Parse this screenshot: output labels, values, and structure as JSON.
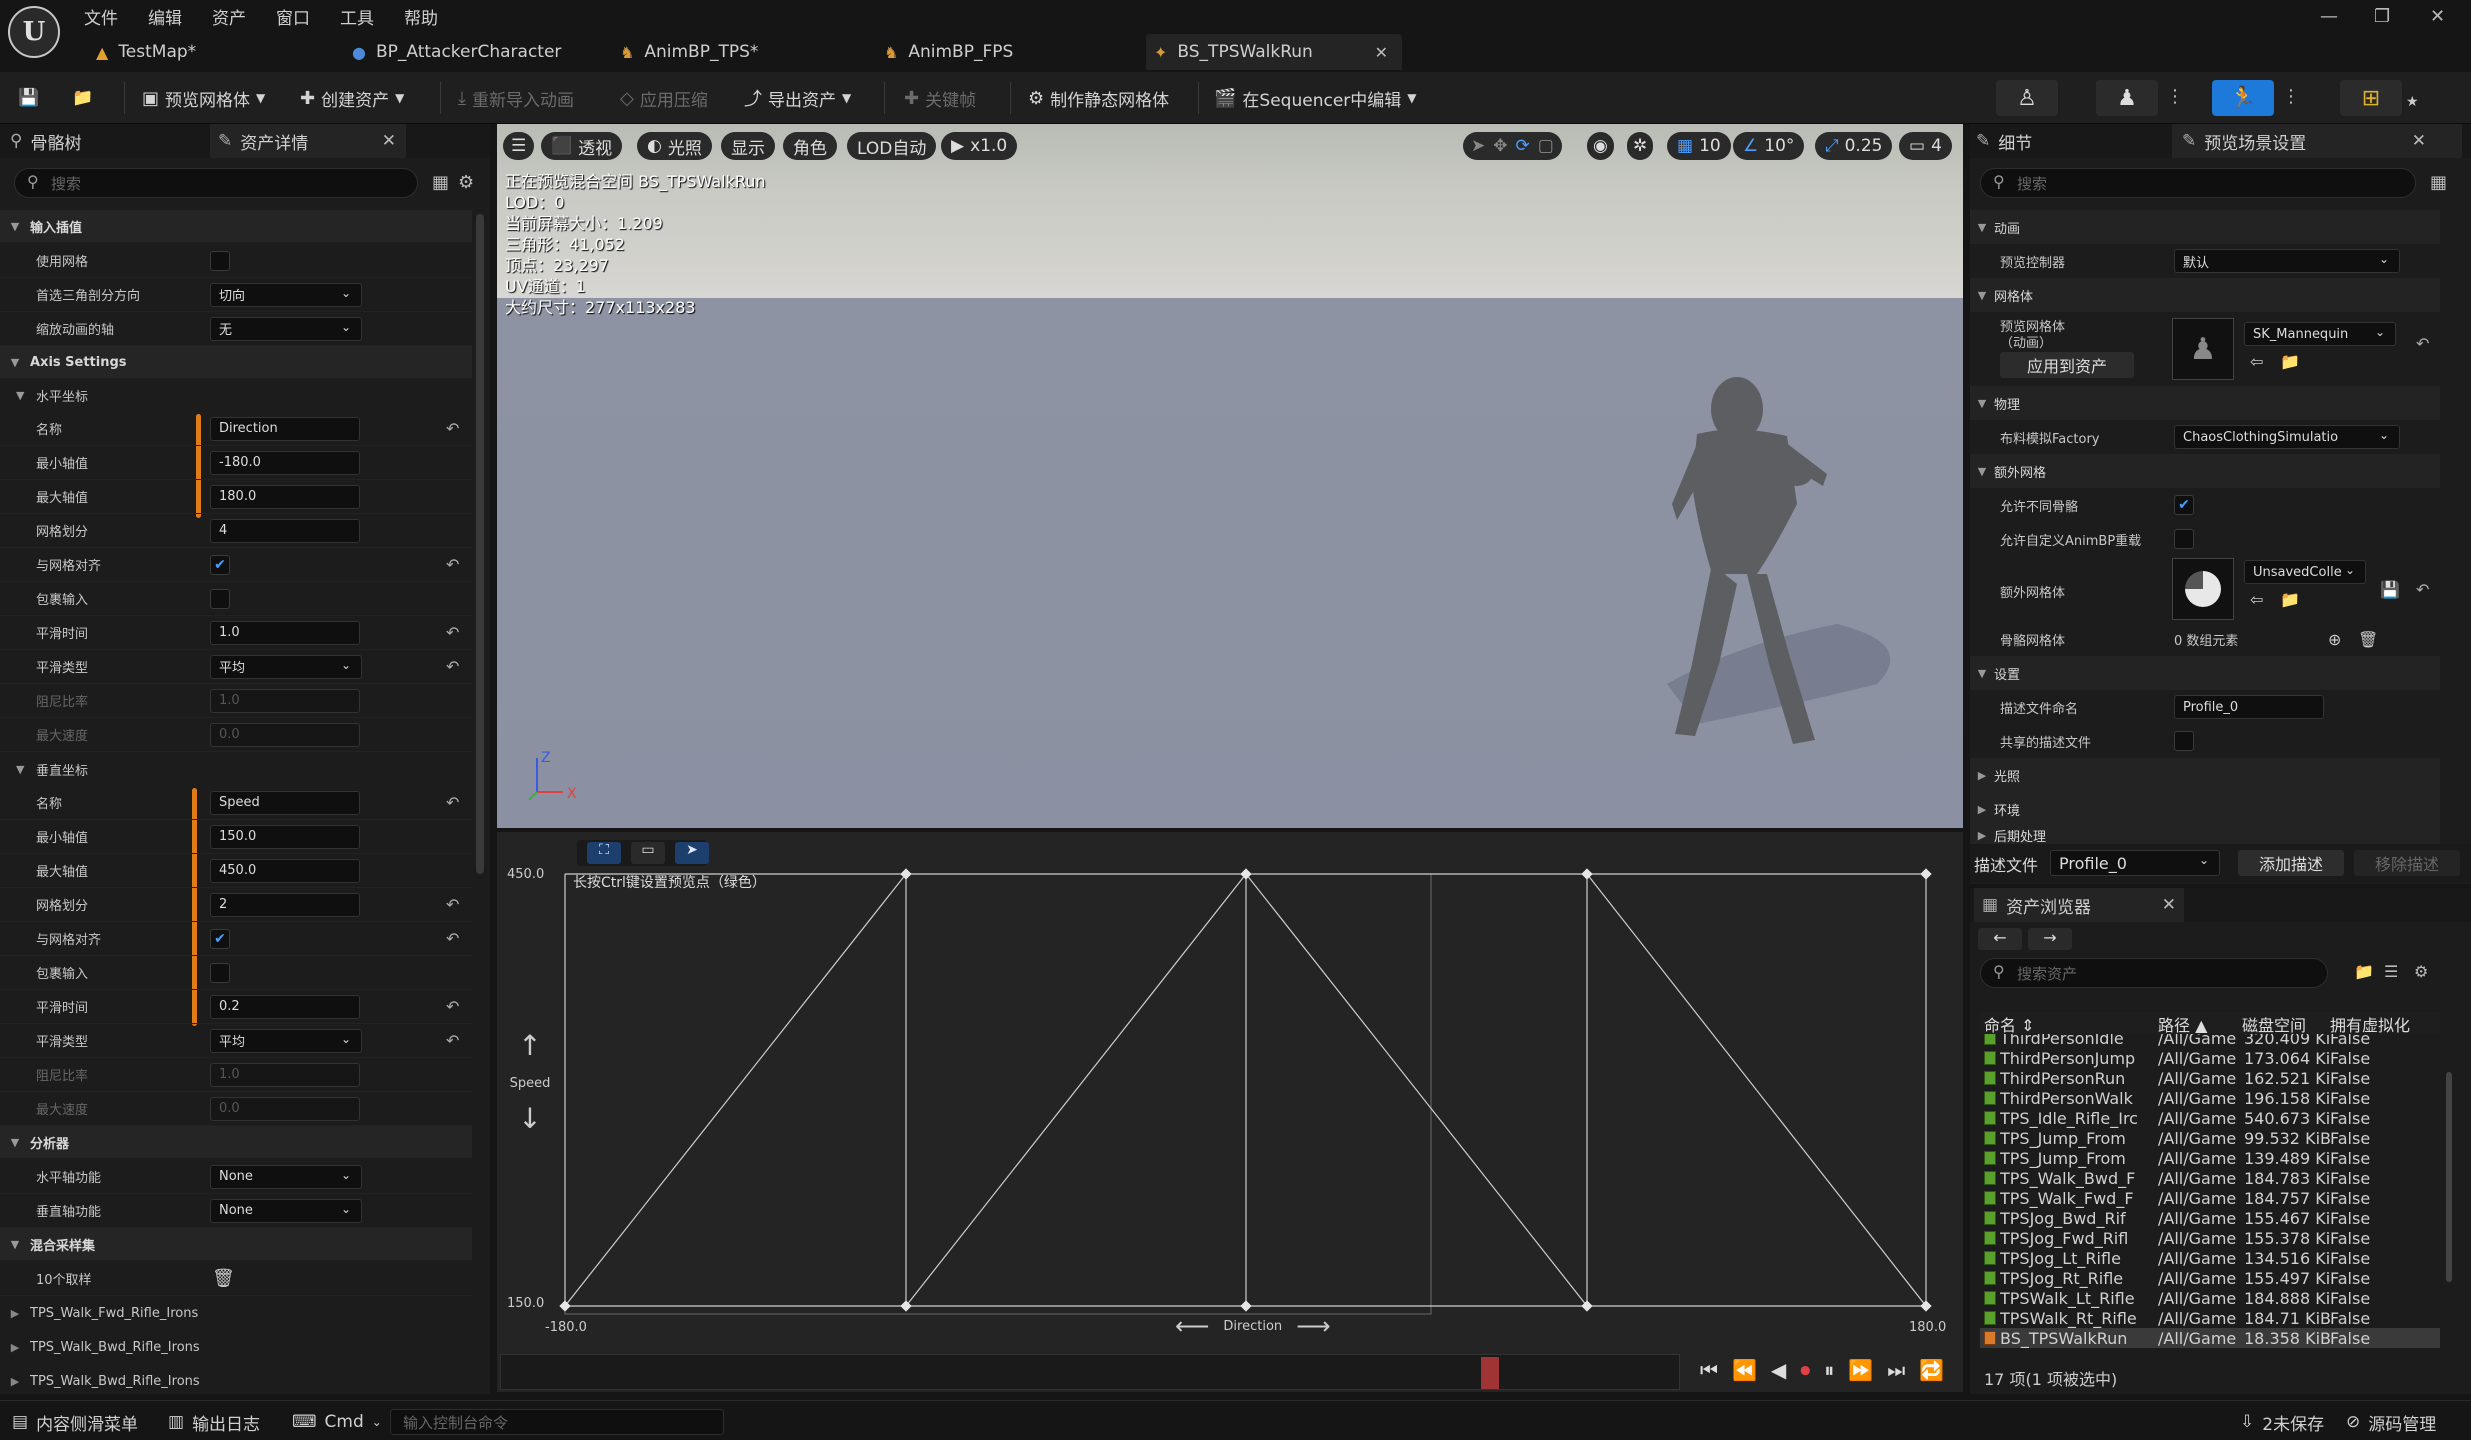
{
  "menu": [
    "文件",
    "编辑",
    "资产",
    "窗口",
    "工具",
    "帮助"
  ],
  "tabs": [
    {
      "label": "TestMap*"
    },
    {
      "label": "BP_AttackerCharacter"
    },
    {
      "label": "AnimBP_TPS*"
    },
    {
      "label": "AnimBP_FPS"
    },
    {
      "label": "BS_TPSWalkRun"
    }
  ],
  "toolbar": {
    "preview_mesh": "预览网格体",
    "create_asset": "创建资产",
    "reimport": "重新导入动画",
    "apply_compression": "应用压缩",
    "export_asset": "导出资产",
    "keyframe": "关键帧",
    "make_static_mesh": "制作静态网格体",
    "edit_in_sequencer": "在Sequencer中编辑"
  },
  "left": {
    "tab_skeleton": "骨骼树",
    "tab_details": "资产详情",
    "search_placeholder": "搜索",
    "cat_input": "输入插值",
    "use_grid": "使用网格",
    "preferred_tri": "首选三角剖分方向",
    "preferred_tri_val": "切向",
    "scale_anim_axis": "缩放动画的轴",
    "scale_anim_axis_val": "无",
    "cat_axis": "Axis Settings",
    "horizontal": "水平坐标",
    "vertical": "垂直坐标",
    "name": "名称",
    "min": "最小轴值",
    "max": "最大轴值",
    "grid_div": "网格划分",
    "snap_grid": "与网格对齐",
    "wrap_input": "包裹输入",
    "smooth_time": "平滑时间",
    "smooth_type": "平滑类型",
    "damping": "阻尼比率",
    "max_speed": "最大速度",
    "h_name": "Direction",
    "h_min": "-180.0",
    "h_max": "180.0",
    "h_grid": "4",
    "h_smooth": "1.0",
    "h_smooth_type": "平均",
    "h_damping": "1.0",
    "h_maxspeed": "0.0",
    "v_name": "Speed",
    "v_min": "150.0",
    "v_max": "450.0",
    "v_grid": "2",
    "v_smooth": "0.2",
    "v_smooth_type": "平均",
    "v_damping": "1.0",
    "v_maxspeed": "0.0",
    "cat_analysis": "分析器",
    "h_analysis": "水平轴功能",
    "h_analysis_val": "None",
    "v_analysis": "垂直轴功能",
    "v_analysis_val": "None",
    "cat_samples": "混合采样集",
    "sample_count": "10个取样",
    "samples": [
      "TPS_Walk_Fwd_Rifle_Irons",
      "TPS_Walk_Bwd_Rifle_Irons",
      "TPS_Walk_Bwd_Rifle_Irons"
    ]
  },
  "viewport": {
    "perspective": "透视",
    "lighting": "光照",
    "show": "显示",
    "character": "角色",
    "lod_auto": "LOD自动",
    "speed": "x1.0",
    "grid_val": "10",
    "angle_val": "10°",
    "scale_val": "0.25",
    "cam_val": "4",
    "info": [
      "正在预览混合空间 BS_TPSWalkRun",
      "LOD：0",
      "当前屏幕大小：1.209",
      "三角形：41,052",
      "顶点：23,297",
      "UV通道：1",
      "大约尺寸：277x113x283"
    ]
  },
  "blendspace": {
    "hint": "长按Ctrl键设置预览点（绿色）",
    "y_max": "450.0",
    "y_min": "150.0",
    "x_min": "-180.0",
    "x_max": "180.0",
    "x_label": "Direction",
    "y_label": "Speed"
  },
  "right": {
    "tab_details": "细节",
    "tab_preview": "预览场景设置",
    "search_placeholder": "搜索",
    "cat_anim": "动画",
    "preview_controller": "预览控制器",
    "preview_controller_val": "默认",
    "cat_mesh": "网格体",
    "preview_mesh": "预览网格体\n（动画）",
    "preview_mesh_val": "SK_Mannequin",
    "apply_to_asset": "应用到资产",
    "cat_physics": "物理",
    "cloth_factory": "布料模拟Factory",
    "cloth_factory_val": "ChaosClothingSimulatio",
    "cat_extra": "额外网格",
    "allow_diff_skel": "允许不同骨骼",
    "allow_custom_bp": "允许自定义AnimBP重载",
    "extra_mesh": "额外网格体",
    "extra_mesh_val": "UnsavedColle",
    "skel_meshes": "骨骼网格体",
    "skel_meshes_val": "0 数组元素",
    "cat_settings": "设置",
    "profile_name": "描述文件命名",
    "profile_name_val": "Profile_0",
    "shared_profile": "共享的描述文件",
    "cat_light": "光照",
    "cat_env": "环境",
    "cat_post": "后期处理",
    "profile_label": "描述文件",
    "profile_combo": "Profile_0",
    "add_profile": "添加描述",
    "remove_profile": "移除描述"
  },
  "assets": {
    "title": "资产浏览器",
    "search_placeholder": "搜索资产",
    "headers": [
      "命名",
      "路径",
      "磁盘空间",
      "拥有虚拟化"
    ],
    "rows": [
      [
        "ThirdPersonIdle",
        "/All/Game",
        "320.409 Ki",
        "False"
      ],
      [
        "ThirdPersonJump",
        "/All/Game",
        "173.064 Ki",
        "False"
      ],
      [
        "ThirdPersonRun",
        "/All/Game",
        "162.521 Ki",
        "False"
      ],
      [
        "ThirdPersonWalk",
        "/All/Game",
        "196.158 Ki",
        "False"
      ],
      [
        "TPS_Idle_Rifle_Irc",
        "/All/Game",
        "540.673 Ki",
        "False"
      ],
      [
        "TPS_Jump_From",
        "/All/Game",
        "99.532 KiB",
        "False"
      ],
      [
        "TPS_Jump_From",
        "/All/Game",
        "139.489 Ki",
        "False"
      ],
      [
        "TPS_Walk_Bwd_F",
        "/All/Game",
        "184.783 Ki",
        "False"
      ],
      [
        "TPS_Walk_Fwd_F",
        "/All/Game",
        "184.757 Ki",
        "False"
      ],
      [
        "TPSJog_Bwd_Rif",
        "/All/Game",
        "155.467 Ki",
        "False"
      ],
      [
        "TPSJog_Fwd_Rifl",
        "/All/Game",
        "155.378 Ki",
        "False"
      ],
      [
        "TPSJog_Lt_Rifle",
        "/All/Game",
        "134.516 Ki",
        "False"
      ],
      [
        "TPSJog_Rt_Rifle",
        "/All/Game",
        "155.497 Ki",
        "False"
      ],
      [
        "TPSWalk_Lt_Rifle",
        "/All/Game",
        "184.888 Ki",
        "False"
      ],
      [
        "TPSWalk_Rt_Rifle",
        "/All/Game",
        "184.71 KiB",
        "False"
      ],
      [
        "BS_TPSWalkRun",
        "/All/Game",
        "18.358 KiB",
        "False"
      ]
    ],
    "count": "17 项(1 项被选中)"
  },
  "status": {
    "content_drawer": "内容侧滑菜单",
    "output_log": "输出日志",
    "cmd": "Cmd",
    "console_placeholder": "输入控制台命令",
    "unsaved": "2未保存",
    "source_control": "源码管理"
  }
}
